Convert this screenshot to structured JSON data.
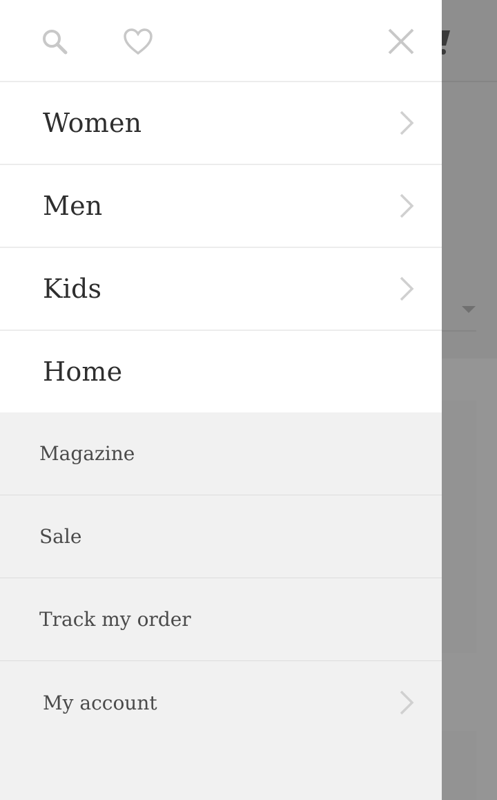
{
  "drawer": {
    "top_icons": {
      "search": "search-icon",
      "wishlist": "heart-icon",
      "close": "close-icon"
    },
    "primary_items": [
      {
        "label": "Women",
        "has_submenu": true
      },
      {
        "label": "Men",
        "has_submenu": true
      },
      {
        "label": "Kids",
        "has_submenu": true
      },
      {
        "label": "Home",
        "has_submenu": false
      }
    ],
    "secondary_items": [
      {
        "label": "Magazine",
        "has_submenu": false
      },
      {
        "label": "Sale",
        "has_submenu": false
      },
      {
        "label": "Track my order",
        "has_submenu": false
      },
      {
        "label": "My account",
        "has_submenu": true
      }
    ]
  },
  "colors": {
    "drawer_bg": "#ffffff",
    "secondary_bg": "#f1f1f1",
    "icon_gray": "#c8c8c8",
    "overlay": "#959595"
  }
}
